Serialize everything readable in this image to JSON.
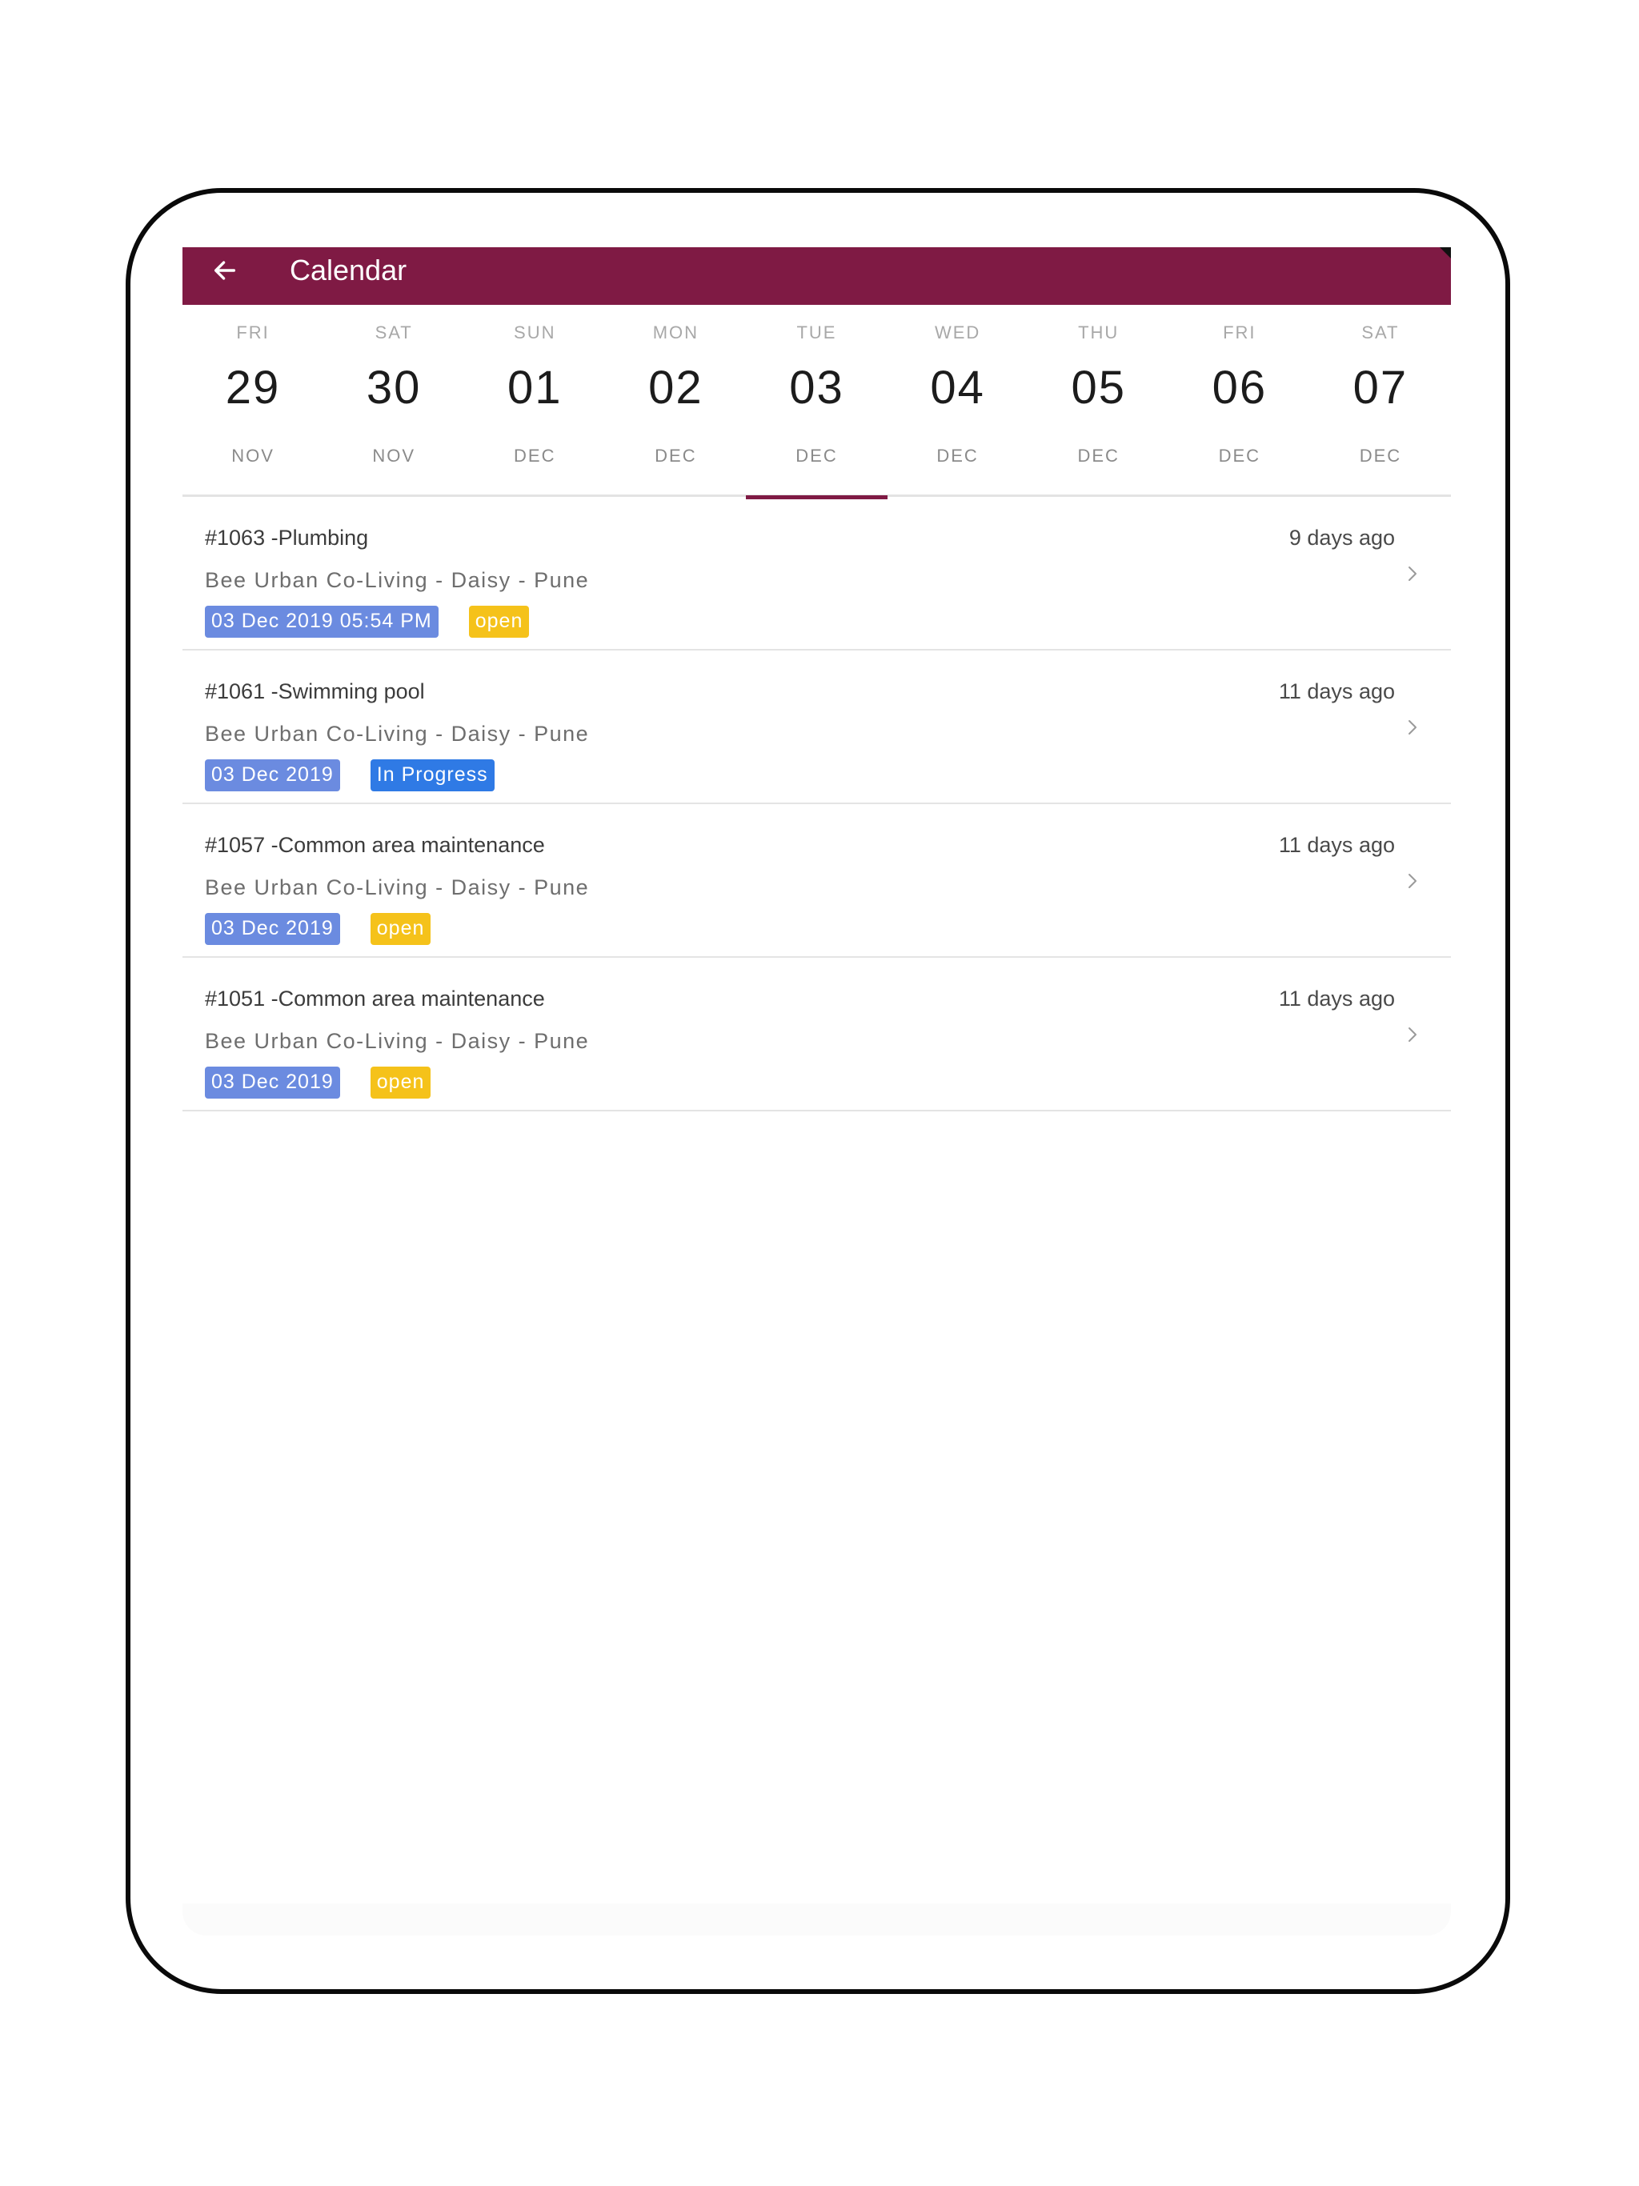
{
  "appbar": {
    "title": "Calendar",
    "background": "#7f1a44"
  },
  "days": [
    {
      "dow": "FRI",
      "num": "29",
      "mon": "NOV",
      "selected": false
    },
    {
      "dow": "SAT",
      "num": "30",
      "mon": "NOV",
      "selected": false
    },
    {
      "dow": "SUN",
      "num": "01",
      "mon": "DEC",
      "selected": false
    },
    {
      "dow": "MON",
      "num": "02",
      "mon": "DEC",
      "selected": false
    },
    {
      "dow": "TUE",
      "num": "03",
      "mon": "DEC",
      "selected": true
    },
    {
      "dow": "WED",
      "num": "04",
      "mon": "DEC",
      "selected": false
    },
    {
      "dow": "THU",
      "num": "05",
      "mon": "DEC",
      "selected": false
    },
    {
      "dow": "FRI",
      "num": "06",
      "mon": "DEC",
      "selected": false
    },
    {
      "dow": "SAT",
      "num": "07",
      "mon": "DEC",
      "selected": false
    }
  ],
  "tickets": [
    {
      "title": "#1063 -Plumbing",
      "ago": "9 days ago",
      "location": "Bee Urban Co-Living - Daisy - Pune",
      "date": "03 Dec 2019 05:54 PM",
      "status": "open",
      "status_type": "open"
    },
    {
      "title": "#1061 -Swimming pool",
      "ago": "11 days ago",
      "location": "Bee Urban Co-Living - Daisy - Pune",
      "date": "03 Dec 2019",
      "status": "In Progress",
      "status_type": "progress"
    },
    {
      "title": "#1057 -Common area maintenance",
      "ago": "11 days ago",
      "location": "Bee Urban Co-Living - Daisy - Pune",
      "date": "03 Dec 2019",
      "status": "open",
      "status_type": "open"
    },
    {
      "title": "#1051 -Common area maintenance",
      "ago": "11 days ago",
      "location": "Bee Urban Co-Living - Daisy - Pune",
      "date": "03 Dec 2019",
      "status": "open",
      "status_type": "open"
    }
  ],
  "colors": {
    "accent": "#7f1a44",
    "date_badge": "#6b8be0",
    "open_badge": "#f5c21a",
    "progress_badge": "#2f7ae5"
  },
  "icons": {
    "back": "arrow-left-icon",
    "chevron": "chevron-right-icon"
  }
}
